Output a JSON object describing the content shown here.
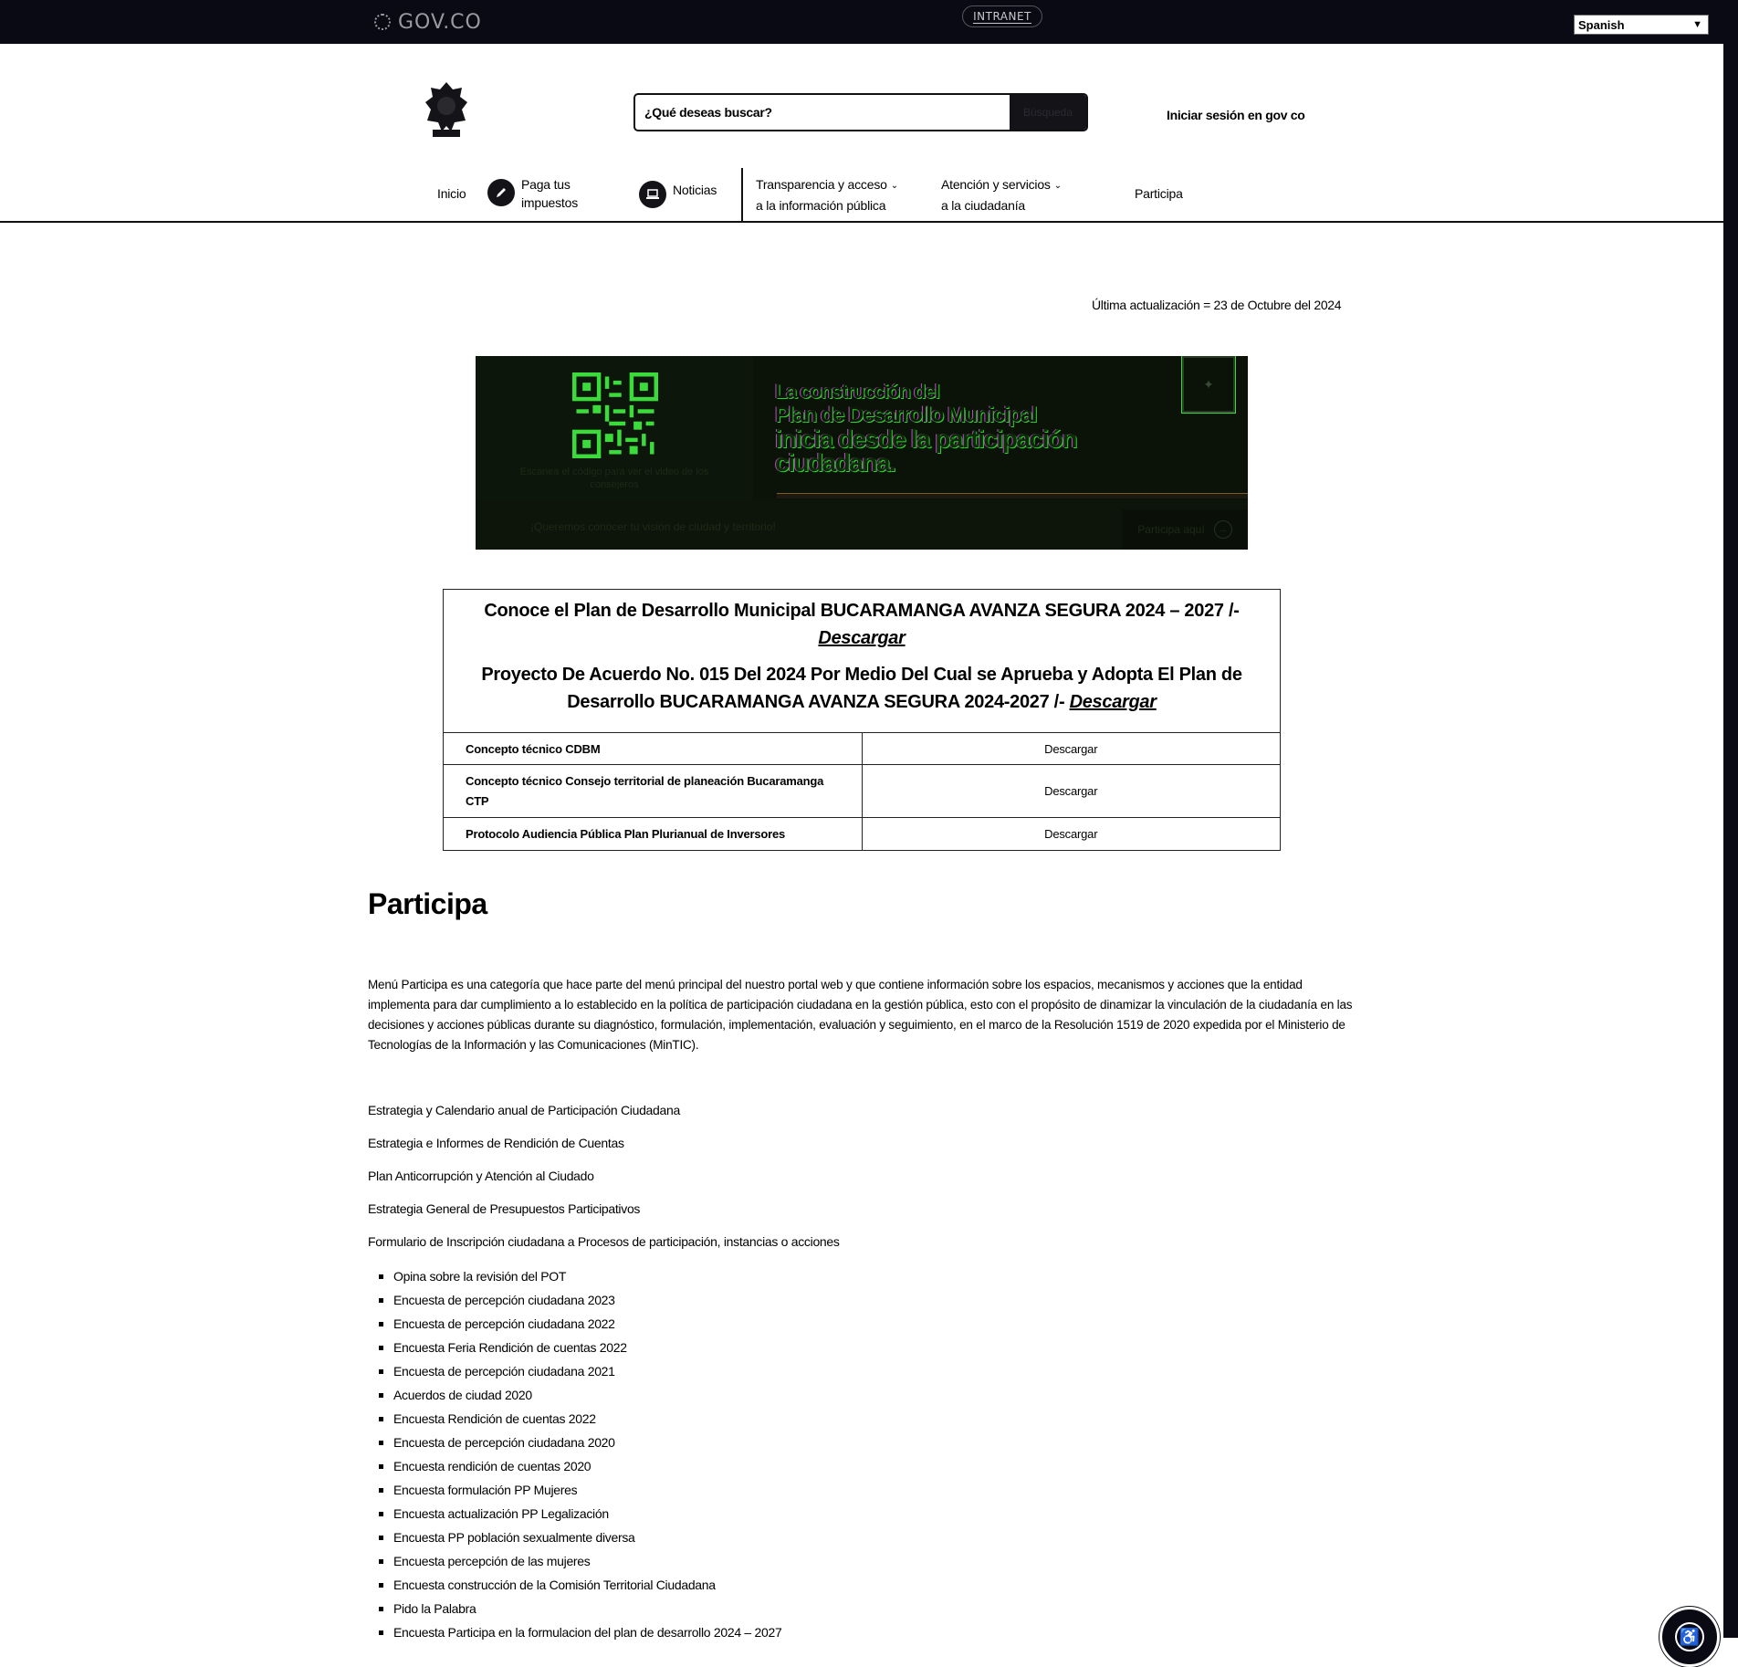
{
  "topbar": {
    "logo_text": "GOV.CO",
    "intranet_label": "INTRANET",
    "language_value": "Spanish"
  },
  "header": {
    "search_placeholder": "¿Qué deseas buscar?",
    "search_button": "Búsqueda",
    "login_label": "Iniciar sesión en gov co"
  },
  "nav": {
    "inicio": "Inicio",
    "impuestos_l1": "Paga tus",
    "impuestos_l2": "impuestos",
    "noticias": "Noticias",
    "transparencia_l1": "Transparencia y acceso",
    "transparencia_l2": "a la información pública",
    "atencion_l1": "Atención y servicios",
    "atencion_l2": "a la ciudadanía",
    "participa": "Participa"
  },
  "updated": "Última actualización = 23 de Octubre del 2024",
  "banner": {
    "headline_l1": "La construcción del",
    "headline_l2": "Plan de Desarrollo Municipal",
    "headline_l3": "inicia desde la participación",
    "headline_l4": "ciudadana.",
    "qr_caption": "Escanea el código para ver el video de los consejeros",
    "cta_text": "¡Queremos conocer tu visión de ciudad y territorio!",
    "cta_button": "Participa aquí"
  },
  "plan": {
    "heading1": "Conoce el Plan de Desarrollo Municipal  BUCARAMANGA AVANZA SEGURA 2024 – 2027 /-",
    "heading1_link": "Descargar",
    "heading2": "Proyecto De Acuerdo No. 015 Del 2024 Por Medio Del Cual se Aprueba y Adopta El Plan de Desarrollo  BUCARAMANGA AVANZA SEGURA  2024-2027 /-",
    "heading2_link": "Descargar",
    "rows": [
      {
        "label": "Concepto técnico CDBM",
        "action": "Descargar"
      },
      {
        "label": "Concepto técnico Consejo territorial de planeación Bucaramanga CTP",
        "action": "Descargar"
      },
      {
        "label": "Protocolo  Audiencia  Pública Plan Plurianual de Inversores",
        "action": "Descargar"
      }
    ]
  },
  "participa": {
    "title": "Participa",
    "intro": "Menú Participa es una categoría que hace parte del menú principal del nuestro portal web y que contiene información sobre los espacios, mecanismos y acciones que la entidad implementa para dar cumplimiento a lo establecido en la política de participación ciudadana en la gestión pública, esto con el propósito de dinamizar la vinculación de la ciudadanía en las decisiones y acciones públicas durante su diagnóstico, formulación, implementación, evaluación y seguimiento, en el marco de la Resolución 1519 de 2020 expedida por el Ministerio de Tecnologías de la Información y las Comunicaciones (MinTIC).",
    "links": [
      "Estrategia y Calendario anual de Participación Ciudadana",
      "Estrategia e Informes de Rendición de Cuentas",
      "Plan Anticorrupción y Atención al Ciudado",
      "Estrategia General de Presupuestos Participativos",
      "Formulario de Inscripción ciudadana a Procesos de participación, instancias o acciones"
    ],
    "bullets": [
      "Opina sobre la revisión del POT",
      "Encuesta de percepción ciudadana 2023",
      "Encuesta de percepción ciudadana 2022",
      "Encuesta Feria Rendición de cuentas 2022",
      "Encuesta de percepción ciudadana 2021",
      "Acuerdos de ciudad 2020",
      "Encuesta Rendición de cuentas 2022",
      "Encuesta de percepción ciudadana 2020",
      "Encuesta rendición de cuentas 2020",
      "Encuesta formulación PP Mujeres",
      "Encuesta actualización PP Legalización",
      "Encuesta PP población sexualmente diversa",
      "Encuesta percepción de las mujeres",
      "Encuesta construcción de la Comisión Territorial Ciudadana",
      "Pido la Palabra",
      "Encuesta Participa en la formulacion del plan de desarrollo 2024 – 2027"
    ]
  },
  "icons": {
    "gov": "gov-logo-icon",
    "pencil": "pencil-icon",
    "laptop": "laptop-icon",
    "chevron": "chevron-down-icon",
    "arrow": "arrow-right-icon",
    "accessibility": "accessibility-icon"
  },
  "colors": {
    "topbar": "#0a0a14",
    "text": "#000000",
    "banner": "#0b1208",
    "banner_accent": "#2bd42b"
  }
}
